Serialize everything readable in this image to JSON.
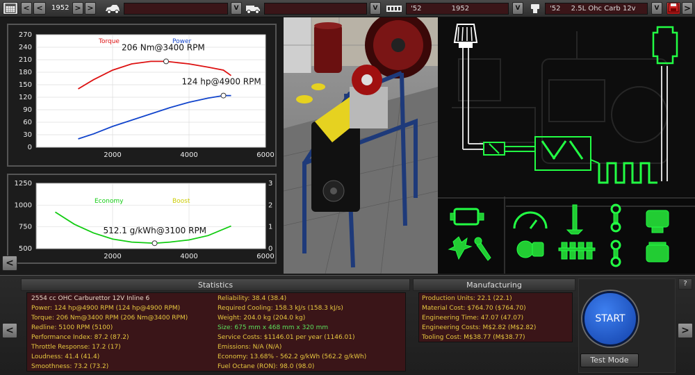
{
  "topbar": {
    "year": "1952",
    "fam_year": "'52",
    "fam_name": "1952",
    "var_year": "'52",
    "var_name": "2.5L Ohc Carb 12v"
  },
  "colors": {
    "torque": "#d11",
    "power": "#14c",
    "economy": "#1c1",
    "boost": "#cc0",
    "field": "#3a1518",
    "accent": "#1e5fd8",
    "glow": "#22ff44"
  },
  "icons": [
    "calendar-icon",
    "car-icon",
    "truck-icon",
    "engine-block-icon",
    "piston-icon",
    "save-icon",
    "air-filter-icon",
    "intake-icon",
    "exhaust-icon",
    "check-engine-icon",
    "gauge-icon",
    "valve-icon",
    "conrod-icon",
    "turbo-icon",
    "wrench-icon",
    "pistons-row-icon",
    "cylinder-icon"
  ],
  "chart_data": [
    {
      "type": "line",
      "x_ticks": [
        "2000",
        "4000",
        "6000"
      ],
      "y_ticks": [
        "0",
        "30",
        "60",
        "90",
        "120",
        "150",
        "180",
        "210",
        "240",
        "270"
      ],
      "xlim": [
        0,
        6000
      ],
      "ylim": [
        0,
        270
      ],
      "grid": true,
      "legend": [
        "Torque",
        "Power"
      ],
      "series": [
        {
          "name": "Torque",
          "color": "#d11",
          "x": [
            1100,
            1500,
            2000,
            2500,
            3000,
            3400,
            4000,
            4500,
            4900,
            5100
          ],
          "y": [
            140,
            162,
            185,
            200,
            206,
            206,
            200,
            192,
            185,
            172
          ]
        },
        {
          "name": "Power",
          "color": "#14c",
          "x": [
            1100,
            1500,
            2000,
            2500,
            3000,
            3500,
            4000,
            4500,
            4900,
            5100
          ],
          "y": [
            20,
            32,
            50,
            65,
            80,
            95,
            108,
            118,
            124,
            124
          ]
        }
      ],
      "annotations": [
        {
          "text": "206 Nm@3400 RPM",
          "x": 3400,
          "y": 206
        },
        {
          "text": "124 hp@4900 RPM",
          "x": 4900,
          "y": 124
        }
      ]
    },
    {
      "type": "line",
      "x_ticks": [
        "2000",
        "4000",
        "6000"
      ],
      "y_ticks_left": [
        "500",
        "750",
        "1000",
        "1250"
      ],
      "y_ticks_right": [
        "0",
        "1",
        "2",
        "3"
      ],
      "xlim": [
        0,
        6000
      ],
      "ylim": [
        500,
        1250
      ],
      "grid": true,
      "legend": [
        "Economy",
        "Boost"
      ],
      "series": [
        {
          "name": "Economy",
          "color": "#1c1",
          "x": [
            500,
            1000,
            1500,
            2000,
            2500,
            3100,
            3500,
            4000,
            4500,
            5100
          ],
          "y": [
            920,
            780,
            680,
            610,
            575,
            562,
            575,
            600,
            650,
            760
          ]
        }
      ],
      "annotations": [
        {
          "text": "512.1 g/kWh@3100 RPM",
          "x": 3100,
          "y": 562
        }
      ]
    }
  ],
  "statistics": {
    "title": "Statistics",
    "left": [
      {
        "text": "2554 cc OHC Carburettor 12V Inline 6",
        "color": "#e8d8c8"
      },
      {
        "text": "Power: 124 hp@4900 RPM (124 hp@4900 RPM)",
        "color": "#e8c840"
      },
      {
        "text": "Torque: 206 Nm@3400 RPM (206 Nm@3400 RPM)",
        "color": "#e8c840"
      },
      {
        "text": "Redline: 5100 RPM (5100)",
        "color": "#e8c840"
      },
      {
        "text": "Performance Index: 87.2 (87.2)",
        "color": "#e8c840"
      },
      {
        "text": "Throttle Response: 17.2 (17)",
        "color": "#e8c840"
      },
      {
        "text": "Loudness: 41.4 (41.4)",
        "color": "#e8c840"
      },
      {
        "text": "Smoothness: 73.2 (73.2)",
        "color": "#e8c840"
      }
    ],
    "right": [
      {
        "text": "Reliability: 38.4 (38.4)",
        "color": "#e8c840"
      },
      {
        "text": "Required Cooling: 158.3 kJ/s (158.3 kJ/s)",
        "color": "#e8c840"
      },
      {
        "text": "Weight: 204.0 kg (204.0 kg)",
        "color": "#e8c840"
      },
      {
        "text": "Size: 675 mm x 468 mm x 320 mm",
        "color": "#5ce05c"
      },
      {
        "text": "Service Costs: $1146.01 per year (1146.01)",
        "color": "#e8c840"
      },
      {
        "text": "Emissions: N/A (N/A)",
        "color": "#e8c840"
      },
      {
        "text": "Economy: 13.68% - 562.2 g/kWh (562.2 g/kWh)",
        "color": "#e8c840"
      },
      {
        "text": "Fuel Octane (RON): 98.0 (98.0)",
        "color": "#e8c840"
      }
    ]
  },
  "manufacturing": {
    "title": "Manufacturing",
    "lines": [
      "Production Units: 22.1 (22.1)",
      "Material Cost: $764.70 ($764.70)",
      "Engineering Time: 47.07 (47.07)",
      "Engineering Costs: M$2.82 (M$2.82)",
      "Tooling Cost: M$38.77 (M$38.77)"
    ]
  },
  "start_label": "START",
  "test_mode_label": "Test Mode",
  "help_label": "?"
}
